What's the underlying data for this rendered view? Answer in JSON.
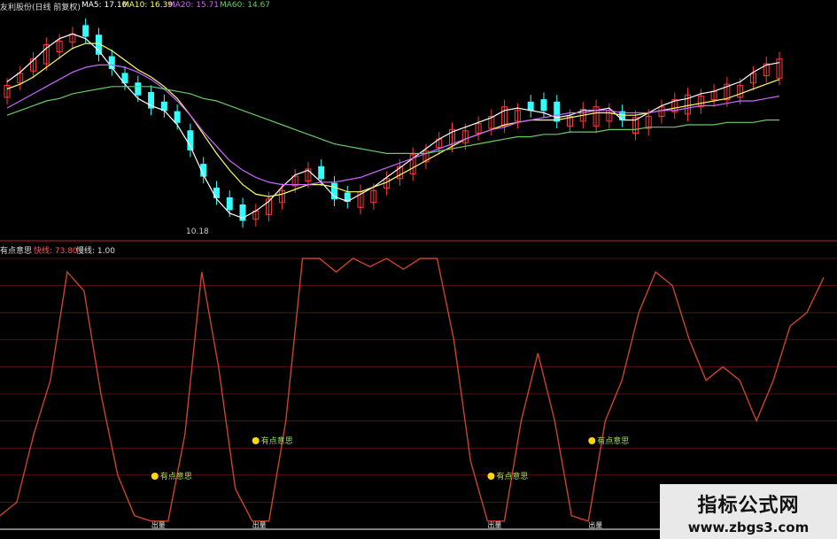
{
  "header_top": {
    "title": "友利股份(日线 前复权)",
    "ma5": "MA5: 17.10",
    "ma10": "MA10: 16.39",
    "ma20": "MA20: 15.71",
    "ma60": "MA60: 14.67"
  },
  "header_bottom": {
    "indicator": "有点意思",
    "fast_line": "快线: 73.80",
    "slow_line": "慢线: 1.00"
  },
  "low_price_label": "10.18",
  "signal_label": "有点意思",
  "bottom_marker_label": "出量",
  "watermark": {
    "title": "指标公式网",
    "url": "www.zbgs3.com"
  },
  "colors": {
    "background": "#000000",
    "up_candle": "#ff3b3b",
    "down_candle": "#33ffff",
    "ma5": "#ffffff",
    "ma10": "#ffff66",
    "ma20": "#cc66ff",
    "ma60": "#66cc66",
    "oscillator": "#c8442c",
    "grid": "#5a1010",
    "signal_dot": "#ffd700"
  },
  "chart_data": [
    {
      "type": "line",
      "panel": "price",
      "series": [
        {
          "name": "MA5",
          "values": [
            16.3,
            16.7,
            17.2,
            17.7,
            18.1,
            18.3,
            18.1,
            17.6,
            16.9,
            16.2,
            15.6,
            15.3,
            15.1,
            14.5,
            13.6,
            12.4,
            11.4,
            10.8,
            10.6,
            10.9,
            11.3,
            11.9,
            12.4,
            12.6,
            12.1,
            11.5,
            11.3,
            11.6,
            11.9,
            12.3,
            12.7,
            13.1,
            13.5,
            13.9,
            14.2,
            14.4,
            14.6,
            14.8,
            15.1,
            15.2,
            15.1,
            15.0,
            14.8,
            14.9,
            15.1,
            15.1,
            15.2,
            14.7,
            14.7,
            15.0,
            15.3,
            15.5,
            15.6,
            15.8,
            15.9,
            16.1,
            16.3,
            16.7,
            17.0,
            17.1
          ]
        },
        {
          "name": "MA10",
          "values": [
            16.0,
            16.2,
            16.5,
            16.9,
            17.3,
            17.7,
            17.9,
            17.9,
            17.6,
            17.2,
            16.8,
            16.5,
            16.1,
            15.6,
            14.9,
            14.1,
            13.3,
            12.6,
            12.0,
            11.6,
            11.5,
            11.6,
            11.8,
            12.0,
            12.0,
            11.9,
            11.7,
            11.7,
            11.9,
            12.1,
            12.4,
            12.7,
            13.0,
            13.3,
            13.6,
            13.9,
            14.1,
            14.3,
            14.5,
            14.6,
            14.7,
            14.7,
            14.7,
            14.8,
            14.9,
            15.0,
            15.0,
            14.9,
            14.9,
            15.0,
            15.1,
            15.2,
            15.3,
            15.4,
            15.5,
            15.6,
            15.8,
            16.0,
            16.2,
            16.4
          ]
        },
        {
          "name": "MA20",
          "values": [
            15.2,
            15.5,
            15.8,
            16.1,
            16.4,
            16.7,
            16.9,
            17.0,
            17.0,
            16.9,
            16.7,
            16.4,
            16.0,
            15.5,
            14.9,
            14.2,
            13.6,
            13.0,
            12.6,
            12.3,
            12.1,
            12.0,
            12.0,
            12.0,
            12.1,
            12.1,
            12.2,
            12.3,
            12.5,
            12.7,
            12.9,
            13.1,
            13.3,
            13.5,
            13.7,
            13.9,
            14.1,
            14.3,
            14.4,
            14.6,
            14.7,
            14.8,
            14.9,
            15.0,
            15.0,
            15.1,
            15.1,
            15.0,
            15.0,
            15.0,
            15.1,
            15.1,
            15.2,
            15.3,
            15.3,
            15.4,
            15.5,
            15.5,
            15.6,
            15.7
          ]
        },
        {
          "name": "MA60",
          "values": [
            14.9,
            15.1,
            15.3,
            15.5,
            15.6,
            15.8,
            15.9,
            16.0,
            16.1,
            16.1,
            16.1,
            16.1,
            16.0,
            15.9,
            15.8,
            15.6,
            15.5,
            15.3,
            15.1,
            14.9,
            14.7,
            14.5,
            14.3,
            14.1,
            13.9,
            13.7,
            13.6,
            13.5,
            13.4,
            13.3,
            13.3,
            13.3,
            13.3,
            13.4,
            13.5,
            13.6,
            13.7,
            13.8,
            13.9,
            14.0,
            14.0,
            14.1,
            14.1,
            14.2,
            14.2,
            14.2,
            14.3,
            14.3,
            14.3,
            14.4,
            14.4,
            14.4,
            14.5,
            14.5,
            14.5,
            14.6,
            14.6,
            14.6,
            14.7,
            14.7
          ]
        }
      ]
    },
    {
      "type": "line",
      "panel": "oscillator",
      "series": [
        {
          "name": "快线",
          "values": [
            5,
            10,
            35,
            55,
            95,
            88,
            50,
            20,
            5,
            3,
            3,
            35,
            95,
            60,
            15,
            3,
            3,
            40,
            100,
            100,
            95,
            100,
            97,
            100,
            96,
            100,
            100,
            70,
            25,
            3,
            3,
            40,
            65,
            40,
            5,
            3,
            40,
            55,
            80,
            95,
            90,
            70,
            55,
            60,
            55,
            40,
            55,
            75,
            80,
            93
          ]
        }
      ],
      "ylim": [
        0,
        100
      ]
    }
  ]
}
